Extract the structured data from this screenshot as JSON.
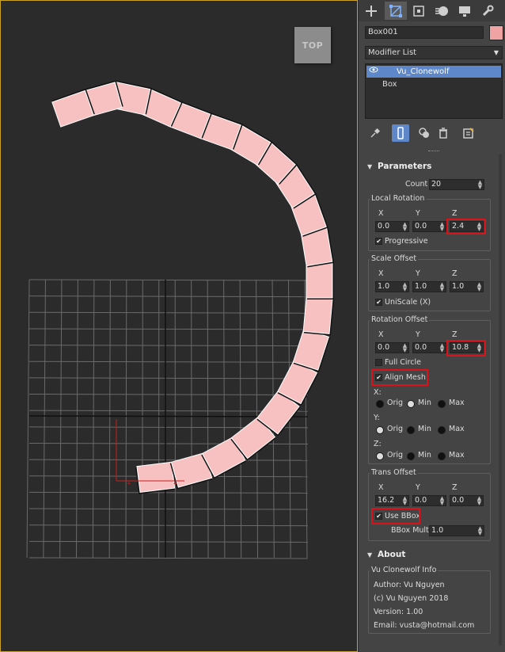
{
  "viewport": {
    "label": "TOP",
    "object_color": "#f7c1c1",
    "clone_count": 20
  },
  "command_panel": {
    "tabs": [
      "create-icon",
      "modify-icon",
      "hierarchy-icon",
      "motion-icon",
      "display-icon",
      "utilities-icon"
    ],
    "object_name": "Box001",
    "object_color": "#f0a3a3",
    "modifier_list_label": "Modifier List",
    "stack": [
      {
        "label": "Vu_Clonewolf",
        "selected": true
      },
      {
        "label": "Box",
        "selected": false
      }
    ]
  },
  "parameters": {
    "title": "Parameters",
    "count_label": "Count",
    "count": "20",
    "local_rotation": {
      "title": "Local Rotation",
      "x_label": "X",
      "y_label": "Y",
      "z_label": "Z",
      "x": "0.0",
      "y": "0.0",
      "z": "2.4",
      "progressive_label": "Progressive",
      "progressive": true
    },
    "scale_offset": {
      "title": "Scale Offset",
      "x_label": "X",
      "y_label": "Y",
      "z_label": "Z",
      "x": "1.0",
      "y": "1.0",
      "z": "1.0",
      "uniscale_label": "UniScale (X)",
      "uniscale": true
    },
    "rotation_offset": {
      "title": "Rotation Offset",
      "x_label": "X",
      "y_label": "Y",
      "z_label": "Z",
      "x": "0.0",
      "y": "0.0",
      "z": "10.8",
      "full_circle_label": "Full Circle",
      "full_circle": false,
      "align_mesh_label": "Align Mesh",
      "align_mesh": true,
      "axis_x_label": "X:",
      "axis_y_label": "Y:",
      "axis_z_label": "Z:",
      "orig_label": "Orig",
      "min_label": "Min",
      "max_label": "Max",
      "x_choice": "Min",
      "y_choice": "Orig",
      "z_choice": "Orig"
    },
    "trans_offset": {
      "title": "Trans Offset",
      "x_label": "X",
      "y_label": "Y",
      "z_label": "Z",
      "x": "16.2",
      "y": "0.0",
      "z": "0.0",
      "use_bbox_label": "Use BBox",
      "use_bbox": true,
      "bbox_mult_label": "BBox Mult.",
      "bbox_mult": "1.0"
    }
  },
  "about": {
    "title": "About",
    "group_title": "Vu Clonewolf Info",
    "author": "Author: Vu Nguyen",
    "copyright": "(c) Vu Nguyen 2018",
    "version": "Version: 1.00",
    "email": "Email: vusta@hotmail.com"
  },
  "highlight_color": "#d8141a"
}
